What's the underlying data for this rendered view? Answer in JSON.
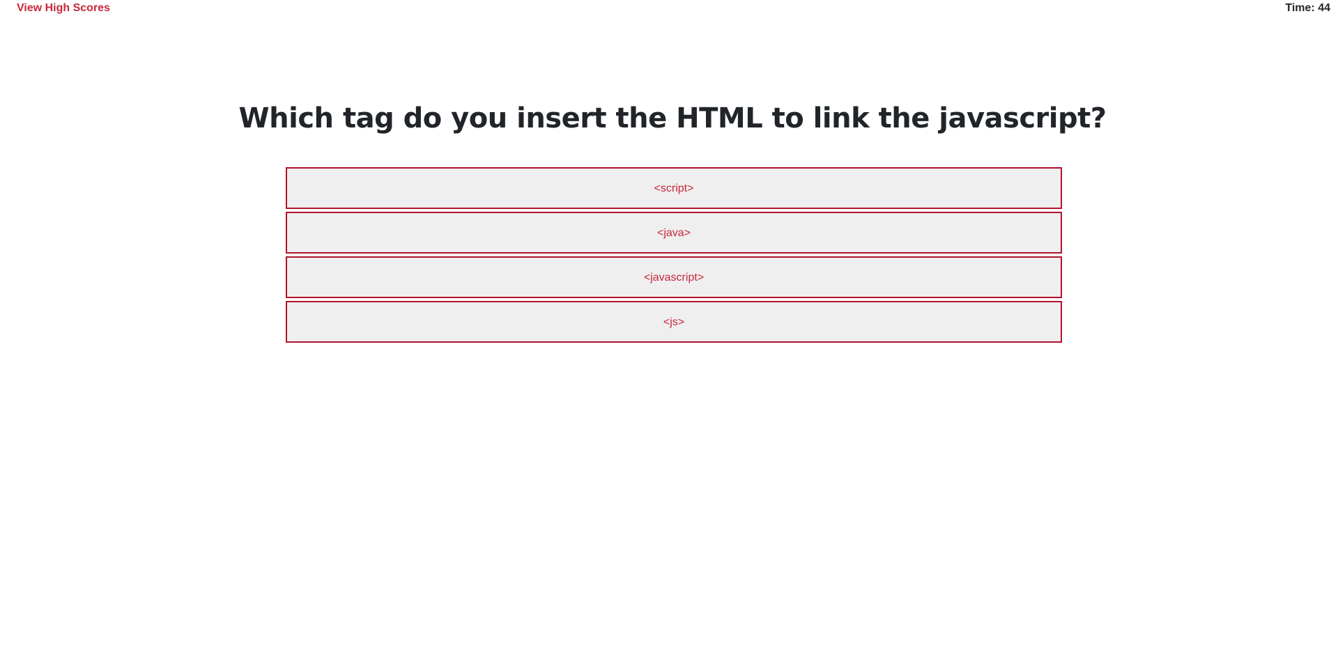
{
  "header": {
    "high_scores_label": "View High Scores",
    "timer_label": "Time: 44"
  },
  "quiz": {
    "question": "Which tag do you insert the HTML to link the javascript?",
    "answers": [
      {
        "label": "<script>"
      },
      {
        "label": "<java>"
      },
      {
        "label": "<javascript>"
      },
      {
        "label": "<js>"
      }
    ]
  },
  "colors": {
    "accent": "#c8273b",
    "button_border": "#b0132c",
    "button_bg": "#efefef",
    "text": "#212529"
  }
}
